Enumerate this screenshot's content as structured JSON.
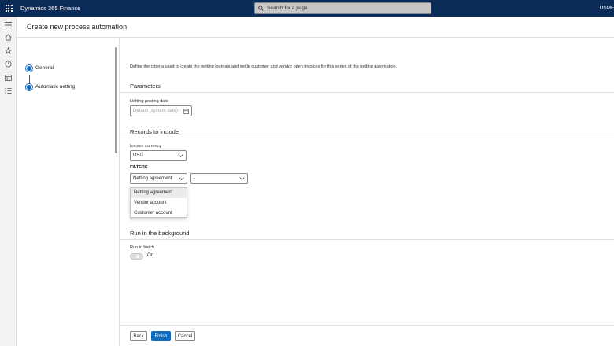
{
  "topbar": {
    "app_name": "Dynamics 365 Finance",
    "search_placeholder": "Search for a page",
    "company": "USMF"
  },
  "nav": {
    "icons": [
      "hamburger-icon",
      "home-icon",
      "star-icon",
      "clock-icon",
      "workspaces-icon",
      "modules-icon"
    ]
  },
  "page": {
    "title": "Create new process automation",
    "intro": "Define the criteria used to create the netting journals and settle customer and vendor open invoices for this series of the netting automation."
  },
  "steps": [
    {
      "label": "General"
    },
    {
      "label": "Automatic netting"
    }
  ],
  "parameters": {
    "title": "Parameters",
    "posting_date_label": "Netting posting date",
    "posting_date_placeholder": "Default (system date)"
  },
  "records": {
    "title": "Records to include",
    "currency_label": "Invoice currency",
    "currency_value": "USD",
    "filters_label": "FILTERS",
    "filter_type_value": "Netting agreement",
    "filter_value": "-",
    "filter_options": [
      "Netting agreement",
      "Vendor account",
      "Customer account"
    ]
  },
  "background": {
    "title": "Run in the background",
    "batch_label": "Run in batch",
    "toggle_text": "On"
  },
  "footer": {
    "back": "Back",
    "finish": "Finish",
    "cancel": "Cancel"
  },
  "colors": {
    "topbar": "#0b2b59",
    "accent": "#0f6cbd"
  }
}
